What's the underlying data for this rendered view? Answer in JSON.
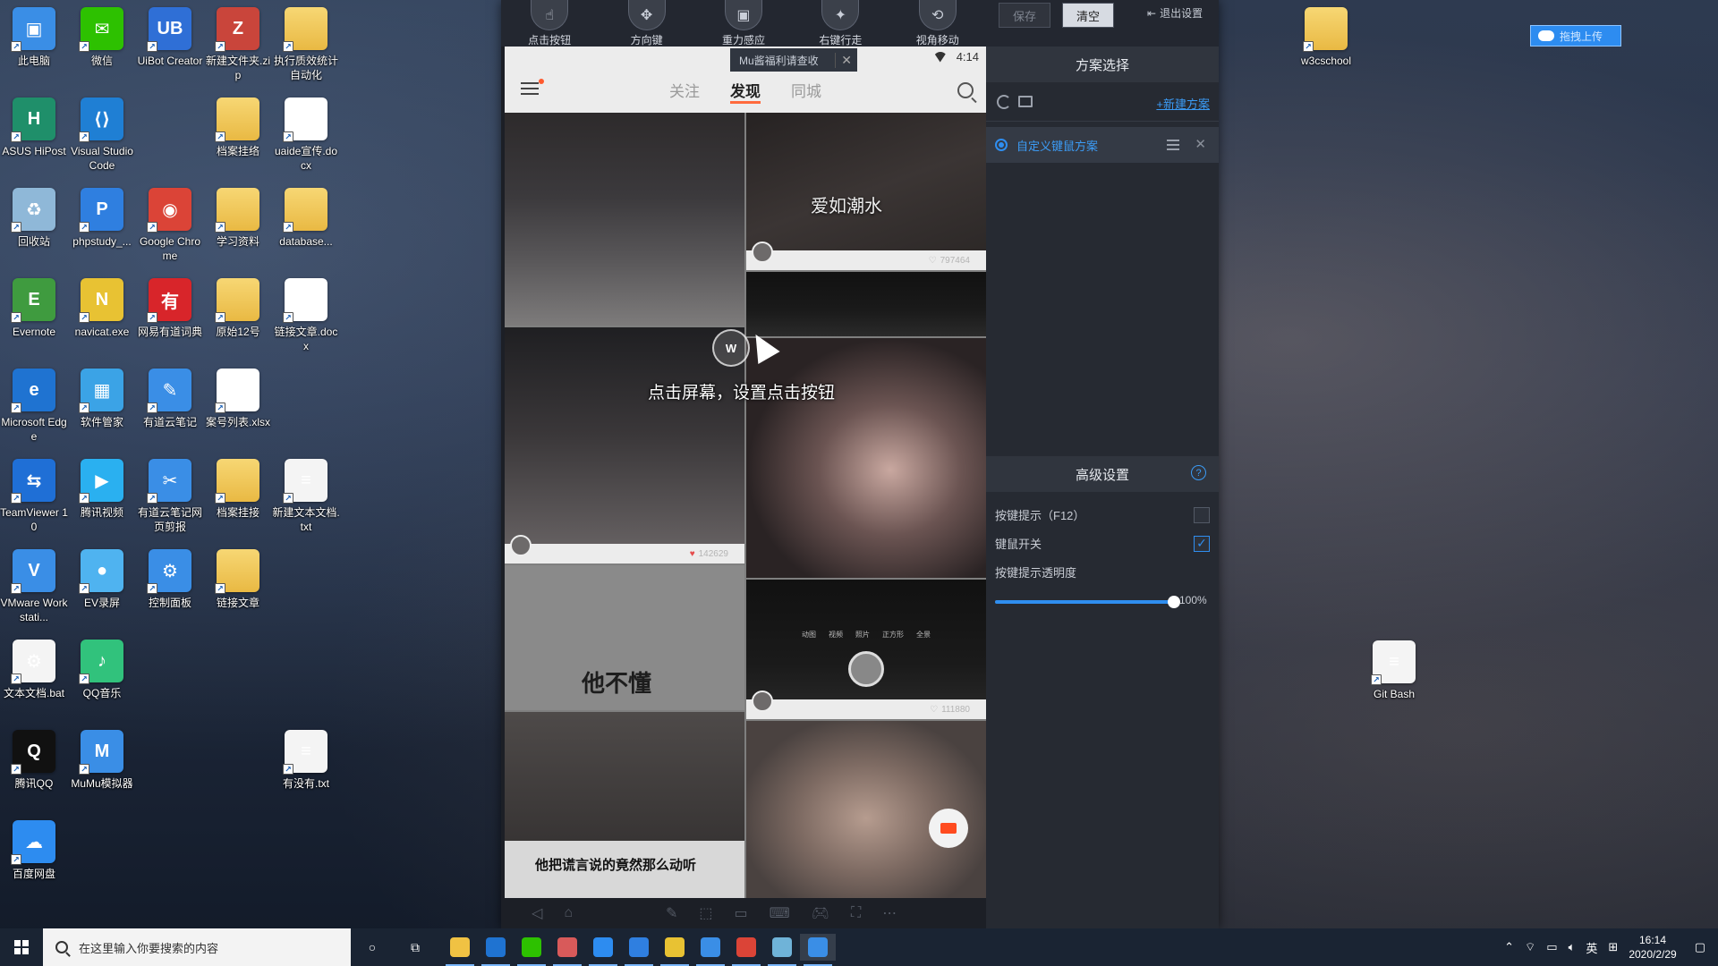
{
  "desktop_icons": [
    {
      "label": "此电脑",
      "icon": "computer-icon",
      "color": "#3a8ee6"
    },
    {
      "label": "微信",
      "icon": "wechat-icon",
      "color": "#2dc100"
    },
    {
      "label": "UiBot Creator",
      "icon": "uibot-icon",
      "color": "#2f6fd6"
    },
    {
      "label": "新建文件夹.zip",
      "icon": "zip-icon",
      "color": "#c9453b"
    },
    {
      "label": "执行质效统计自动化",
      "icon": "zip-folder-icon",
      "color": "#e9b943"
    },
    {
      "label": "ASUS HiPost",
      "icon": "hipost-icon",
      "color": "#1f8f6a"
    },
    {
      "label": "Visual Studio Code",
      "icon": "vscode-icon",
      "color": "#1f7fd4"
    },
    {
      "label": "档案挂络",
      "icon": "zip-folder-icon",
      "color": "#e9b943"
    },
    {
      "label": "uaide宣传.docx",
      "icon": "word-icon",
      "color": "#2b579a"
    },
    {
      "label": "回收站",
      "icon": "recycle-bin-icon",
      "color": "#8fb8d8"
    },
    {
      "label": "phpstudy_...",
      "icon": "phpstudy-icon",
      "color": "#2f7fe0"
    },
    {
      "label": "Google Chrome",
      "icon": "chrome-icon",
      "color": "#db4437"
    },
    {
      "label": "学习资料",
      "icon": "folder-icon",
      "color": "#e9b943"
    },
    {
      "label": "database...",
      "icon": "folder-icon",
      "color": "#e9b943"
    },
    {
      "label": "Evernote",
      "icon": "evernote-icon",
      "color": "#3f9b3f"
    },
    {
      "label": "navicat.exe",
      "icon": "navicat-icon",
      "color": "#e8c233"
    },
    {
      "label": "网易有道词典",
      "icon": "youdao-dict-icon",
      "color": "#d8252a"
    },
    {
      "label": "原始12号",
      "icon": "folder-icon",
      "color": "#e9b943"
    },
    {
      "label": "链接文章.docx",
      "icon": "word-icon",
      "color": "#2b579a"
    },
    {
      "label": "Microsoft Edge",
      "icon": "edge-icon",
      "color": "#1f73d1"
    },
    {
      "label": "软件管家",
      "icon": "software-manager-icon",
      "color": "#3ba3e6"
    },
    {
      "label": "有道云笔记",
      "icon": "youdao-note-icon",
      "color": "#3a8ee6"
    },
    {
      "label": "案号列表.xlsx",
      "icon": "excel-icon",
      "color": "#217346"
    },
    {
      "label": "TeamViewer 10",
      "icon": "teamviewer-icon",
      "color": "#1f6fd6"
    },
    {
      "label": "腾讯视频",
      "icon": "tencent-video-icon",
      "color": "#2ab0f0"
    },
    {
      "label": "有道云笔记网页剪报",
      "icon": "web-clipper-icon",
      "color": "#3a8ee6"
    },
    {
      "label": "档案挂接",
      "icon": "zip-folder-icon",
      "color": "#e9b943"
    },
    {
      "label": "新建文本文档.txt",
      "icon": "text-file-icon",
      "color": "#f0f0f0"
    },
    {
      "label": "VMware Workstati...",
      "icon": "vmware-icon",
      "color": "#3a8ee6"
    },
    {
      "label": "EV录屏",
      "icon": "ev-recorder-icon",
      "color": "#4fb3f0"
    },
    {
      "label": "控制面板",
      "icon": "control-panel-icon",
      "color": "#3a8ee6"
    },
    {
      "label": "链接文章",
      "icon": "zip-folder-icon",
      "color": "#e9b943"
    },
    {
      "label": "文本文档.bat",
      "icon": "bat-file-icon",
      "color": "#d8d8d8"
    },
    {
      "label": "QQ音乐",
      "icon": "qq-music-icon",
      "color": "#31c27c"
    },
    {
      "label": "腾讯QQ",
      "icon": "qq-icon",
      "color": "#111111"
    },
    {
      "label": "MuMu模拟器",
      "icon": "mumu-icon",
      "color": "#3a8ee6"
    },
    {
      "label": "有没有.txt",
      "icon": "text-file-icon",
      "color": "#f0f0f0"
    },
    {
      "label": "百度网盘",
      "icon": "baidu-netdisk-icon",
      "color": "#2d8cf0"
    },
    {
      "label": "w3cschool",
      "icon": "zip-folder-icon",
      "color": "#e9b943"
    },
    {
      "label": "Git Bash",
      "icon": "text-file-icon",
      "color": "#f0f0f0"
    }
  ],
  "emulator": {
    "toolbar": [
      {
        "label": "点击按钮",
        "icon": "tap-hand-icon"
      },
      {
        "label": "方向键",
        "icon": "dpad-icon"
      },
      {
        "label": "重力感应",
        "icon": "gravity-icon"
      },
      {
        "label": "右键行走",
        "icon": "right-click-walk-icon"
      },
      {
        "label": "视角移动",
        "icon": "view-move-icon"
      }
    ],
    "save_label": "保存",
    "clear_label": "清空",
    "exit_label": "退出设置",
    "phone": {
      "time": "4:14",
      "notice": "Mu酱福利请查收",
      "tabs": [
        "关注",
        "发现",
        "同城"
      ],
      "active_tab": "发现",
      "hint": "点击屏幕，设置点击按钮",
      "cards": {
        "text1": "爱如潮水",
        "likes1": "797464",
        "likes2": "142629",
        "text2": "他不懂",
        "likes3": "111880",
        "text3": "他把谎言说的竟然那么动听",
        "camera_modes": [
          "动图",
          "视频",
          "照片",
          "正方形",
          "全景"
        ]
      },
      "cursor_badge": "W"
    },
    "panel": {
      "title": "方案选择",
      "new_plan": "+新建方案",
      "scheme_name": "自定义键鼠方案",
      "advanced_title": "高级设置",
      "key_hint_label": "按键提示（F12）",
      "key_hint_checked": false,
      "mouse_switch_label": "键鼠开关",
      "mouse_switch_checked": true,
      "opacity_label": "按键提示透明度",
      "opacity_value": 100,
      "opacity_text": "100%"
    }
  },
  "upload_widget": {
    "label": "拖拽上传"
  },
  "taskbar": {
    "search_placeholder": "在这里输入你要搜索的内容",
    "pinned": [
      "file-explorer-icon",
      "edge-icon",
      "wechat-icon",
      "app-icon",
      "baidu-netdisk-icon",
      "phpstudy-icon",
      "navicat-icon",
      "window-icon",
      "chrome-icon",
      "notepad-icon",
      "mumu-icon"
    ],
    "ime": "英",
    "time": "16:14",
    "date": "2020/2/29"
  }
}
